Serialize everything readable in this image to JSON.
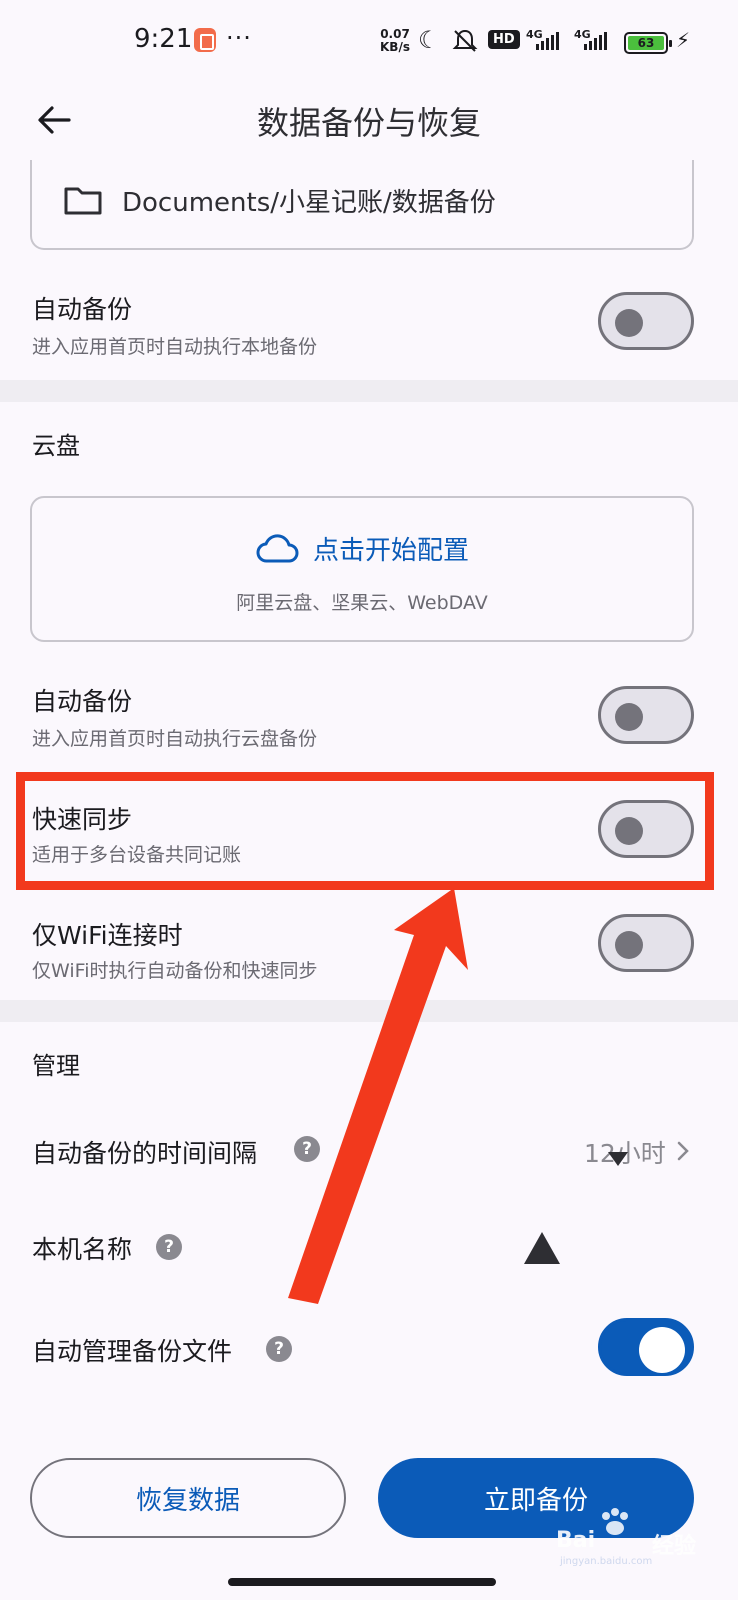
{
  "status_bar": {
    "time": "9:21",
    "more": "···",
    "speed_value": "0.07",
    "speed_unit": "KB/s",
    "hd_label": "HD",
    "net1": "4G",
    "net2": "4G",
    "battery": "63"
  },
  "app_bar": {
    "title": "数据备份与恢复"
  },
  "local": {
    "path": "Documents/小星记账/数据备份",
    "auto_backup_title": "自动备份",
    "auto_backup_sub": "进入应用首页时自动执行本地备份",
    "auto_backup_on": false
  },
  "cloud": {
    "section_label": "云盘",
    "config_link": "点击开始配置",
    "providers": "阿里云盘、坚果云、WebDAV",
    "auto_backup_title": "自动备份",
    "auto_backup_sub": "进入应用首页时自动执行云盘备份",
    "auto_backup_on": false,
    "quick_sync_title": "快速同步",
    "quick_sync_sub": "适用于多台设备共同记账",
    "quick_sync_on": false,
    "wifi_only_title": "仅WiFi连接时",
    "wifi_only_sub": "仅WiFi时执行自动备份和快速同步",
    "wifi_only_on": false
  },
  "manage": {
    "section_label": "管理",
    "interval_title": "自动备份的时间间隔",
    "interval_value": "12小时",
    "device_name_title": "本机名称",
    "auto_manage_title": "自动管理备份文件",
    "auto_manage_on": true,
    "help_glyph": "?"
  },
  "actions": {
    "restore_label": "恢复数据",
    "backup_now_label": "立即备份"
  },
  "watermark": {
    "brand": "Bai",
    "brand2": "经验",
    "url": "jingyan.baidu.com"
  },
  "colors": {
    "accent": "#0b5bb8",
    "annotation_red": "#f2391d",
    "background": "#fbf8fd"
  }
}
